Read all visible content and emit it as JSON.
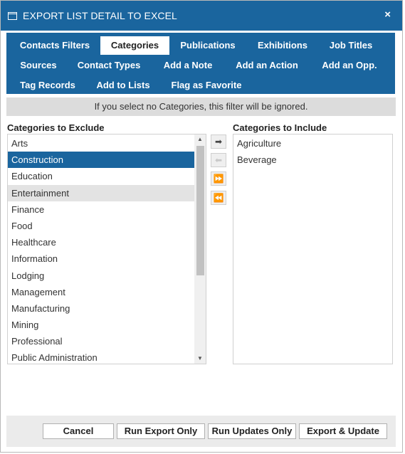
{
  "dialog": {
    "title": "EXPORT LIST DETAIL TO EXCEL",
    "close_glyph": "×"
  },
  "tabs": [
    {
      "label": "Contacts Filters"
    },
    {
      "label": "Categories",
      "active": true
    },
    {
      "label": "Publications"
    },
    {
      "label": "Exhibitions"
    },
    {
      "label": "Job Titles"
    },
    {
      "label": "Sources"
    },
    {
      "label": "Contact Types"
    },
    {
      "label": "Add a Note"
    },
    {
      "label": "Add an Action"
    },
    {
      "label": "Add an Opp."
    },
    {
      "label": "Tag Records"
    },
    {
      "label": "Add to Lists"
    },
    {
      "label": "Flag as Favorite"
    }
  ],
  "notice": "If you select no Categories, this filter will be ignored.",
  "exclude": {
    "label": "Categories to Exclude",
    "items": [
      "Arts",
      "Construction",
      "Education",
      "Entertainment",
      "Finance",
      "Food",
      "Healthcare",
      "Information",
      "Lodging",
      "Management",
      "Manufacturing",
      "Mining",
      "Professional",
      "Public Administration"
    ],
    "selected": "Construction",
    "hovered": "Entertainment"
  },
  "include": {
    "label": "Categories to Include",
    "items": [
      "Agriculture",
      "Beverage"
    ]
  },
  "move_buttons": {
    "move_right": "➡",
    "move_left": "⬅",
    "move_all_right": "⏩",
    "move_all_left": "⏪"
  },
  "scroll_glyphs": {
    "up": "▲",
    "down": "▼"
  },
  "footer": {
    "cancel": "Cancel",
    "run_export": "Run Export Only",
    "run_updates": "Run Updates Only",
    "export_update": "Export & Update"
  },
  "colors": {
    "accent": "#1a659e",
    "notice_bg": "#dcdcdc",
    "hover_bg": "#e3e3e3"
  }
}
